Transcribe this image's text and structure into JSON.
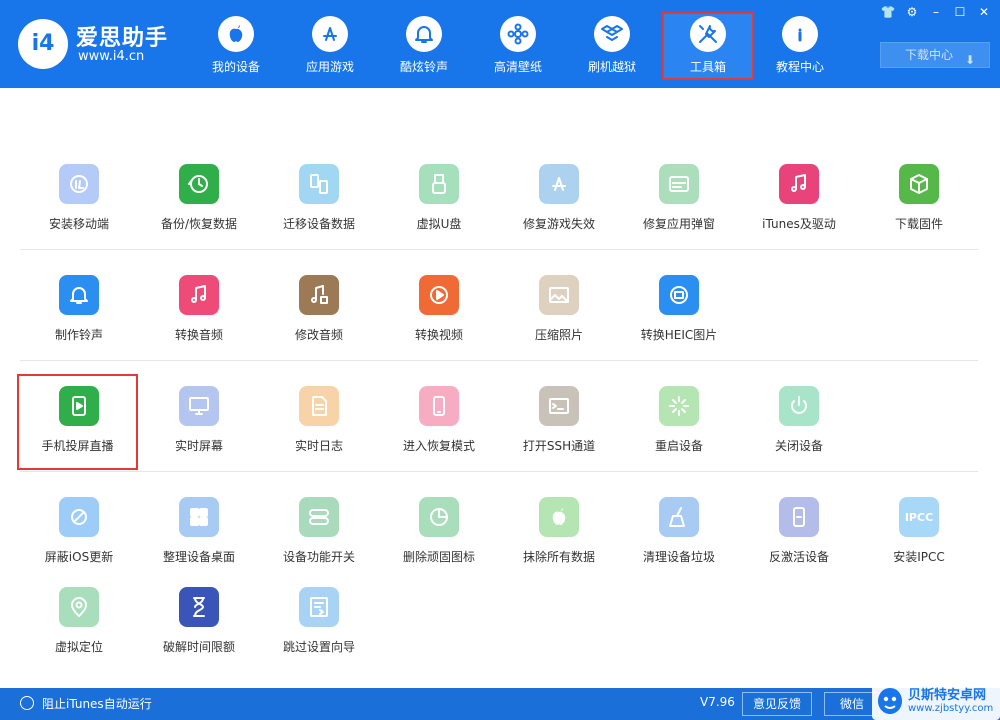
{
  "app": {
    "logo_mark": "i4",
    "title": "爱思助手",
    "url": "www.i4.cn"
  },
  "nav": [
    {
      "label": "我的设备",
      "icon": "apple-icon"
    },
    {
      "label": "应用游戏",
      "icon": "app-store-icon"
    },
    {
      "label": "酷炫铃声",
      "icon": "bell-icon"
    },
    {
      "label": "高清壁纸",
      "icon": "flower-icon"
    },
    {
      "label": "刷机越狱",
      "icon": "dropbox-box-icon"
    },
    {
      "label": "工具箱",
      "icon": "wrench-screwdriver-icon",
      "active": true
    },
    {
      "label": "教程中心",
      "icon": "info-icon"
    }
  ],
  "window_controls": [
    "shirt-icon",
    "gear-icon",
    "minimize-icon",
    "maximize-icon",
    "close-icon"
  ],
  "download_center": "下载中心",
  "tools": [
    [
      {
        "label": "安装移动端",
        "color": "#5b8def",
        "icon": "i4-logo-icon",
        "faded": true
      },
      {
        "label": "备份/恢复数据",
        "color": "#2fae4a",
        "icon": "clock-restore-icon"
      },
      {
        "label": "迁移设备数据",
        "color": "#33a7e8",
        "icon": "phone-transfer-icon",
        "faded": true
      },
      {
        "label": "虚拟U盘",
        "color": "#3cb96a",
        "icon": "usb-icon",
        "faded": true
      },
      {
        "label": "修复游戏失效",
        "color": "#4c9de0",
        "icon": "app-store-icon",
        "faded": true
      },
      {
        "label": "修复应用弹窗",
        "color": "#4cb86a",
        "icon": "apple-id-icon",
        "faded": true
      },
      {
        "label": "iTunes及驱动",
        "color": "#e8437a",
        "icon": "music-gear-icon"
      },
      {
        "label": "下载固件",
        "color": "#56b848",
        "icon": "cube-icon"
      }
    ],
    [
      {
        "label": "制作铃声",
        "color": "#2a8ff0",
        "icon": "bell-plus-icon"
      },
      {
        "label": "转换音频",
        "color": "#ee4b78",
        "icon": "music-note-icon"
      },
      {
        "label": "修改音频",
        "color": "#9c7a55",
        "icon": "music-edit-icon"
      },
      {
        "label": "转换视频",
        "color": "#f06a35",
        "icon": "play-icon"
      },
      {
        "label": "压缩照片",
        "color": "#b89b72",
        "icon": "photo-icon",
        "faded": true
      },
      {
        "label": "转换HEIC图片",
        "color": "#2a8ff0",
        "icon": "heic-photo-icon"
      }
    ],
    [
      {
        "label": "手机投屏直播",
        "color": "#2fae4a",
        "icon": "phone-play-icon",
        "highlight": true
      },
      {
        "label": "实时屏幕",
        "color": "#5b7fe0",
        "icon": "monitor-icon",
        "faded": true
      },
      {
        "label": "实时日志",
        "color": "#f0a040",
        "icon": "document-icon",
        "faded": true
      },
      {
        "label": "进入恢复模式",
        "color": "#ee4b78",
        "icon": "phone-icon",
        "faded": true
      },
      {
        "label": "打开SSH通道",
        "color": "#8a7a66",
        "icon": "terminal-icon",
        "faded": true
      },
      {
        "label": "重启设备",
        "color": "#5fc65a",
        "icon": "loading-icon",
        "faded": true
      },
      {
        "label": "关闭设备",
        "color": "#3ec48a",
        "icon": "power-icon",
        "faded": true
      }
    ],
    [
      {
        "label": "屏蔽iOS更新",
        "color": "#2a8ff0",
        "icon": "gear-block-icon",
        "faded": true
      },
      {
        "label": "整理设备桌面",
        "color": "#3f8ee8",
        "icon": "grid-icon",
        "faded": true
      },
      {
        "label": "设备功能开关",
        "color": "#3fae6a",
        "icon": "toggle-icon",
        "faded": true
      },
      {
        "label": "删除顽固图标",
        "color": "#3fb86a",
        "icon": "pie-icon",
        "faded": true
      },
      {
        "label": "抹除所有数据",
        "color": "#5fc65a",
        "icon": "apple-icon",
        "faded": true
      },
      {
        "label": "清理设备垃圾",
        "color": "#3f8ee8",
        "icon": "broom-icon",
        "faded": true
      },
      {
        "label": "反激活设备",
        "color": "#5b6fd0",
        "icon": "phone-unlock-icon",
        "faded": true
      },
      {
        "label": "安装IPCC",
        "color": "#3fa9f0",
        "icon": "ipcc-icon",
        "icon_text": "IPCC",
        "faded": true
      }
    ],
    [
      {
        "label": "虚拟定位",
        "color": "#3fb86a",
        "icon": "location-pin-icon",
        "faded": true
      },
      {
        "label": "破解时间限额",
        "color": "#3a55b8",
        "icon": "hourglass-icon"
      },
      {
        "label": "跳过设置向导",
        "color": "#3f9ee8",
        "icon": "skip-setup-icon",
        "faded": true
      }
    ]
  ],
  "footer": {
    "itunes_autorun": "阻止iTunes自动运行",
    "version": "V7.96",
    "feedback": "意见反馈",
    "wechat": "微信"
  },
  "watermark": {
    "title": "贝斯特安卓网",
    "url": "www.zjbstyy.com"
  }
}
